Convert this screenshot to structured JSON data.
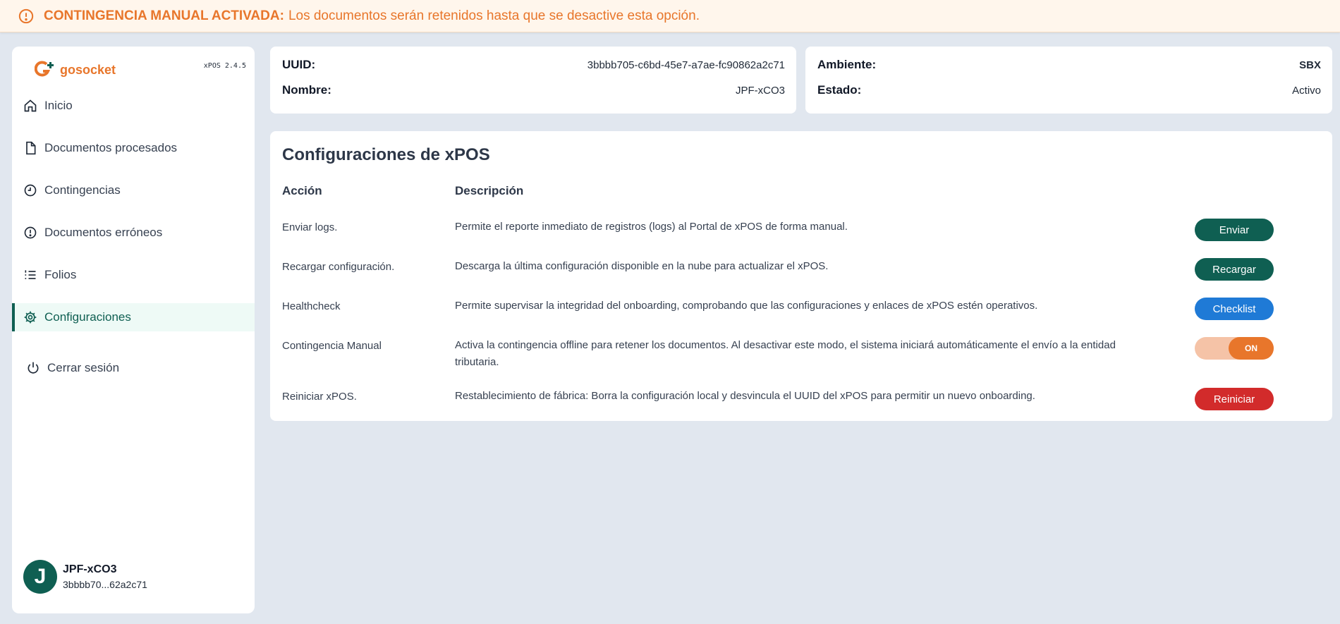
{
  "banner": {
    "title": "CONTINGENCIA MANUAL ACTIVADA:",
    "message": "Los documentos serán retenidos hasta que se desactive esta opción."
  },
  "sidebar": {
    "logo_text": "gosocket",
    "version": "xPOS 2.4.5",
    "items": [
      {
        "label": "Inicio",
        "icon": "home-icon"
      },
      {
        "label": "Documentos procesados",
        "icon": "file-icon"
      },
      {
        "label": "Contingencias",
        "icon": "clock-icon"
      },
      {
        "label": "Documentos erróneos",
        "icon": "alert-circle-icon"
      },
      {
        "label": "Folios",
        "icon": "list-icon"
      },
      {
        "label": "Configuraciones",
        "icon": "gear-icon",
        "active": true
      }
    ],
    "logout_label": "Cerrar sesión",
    "user": {
      "initial": "J",
      "name": "JPF-xCO3",
      "id": "3bbbb70...62a2c71"
    }
  },
  "device": {
    "uuid_label": "UUID:",
    "uuid_value": "3bbbb705-c6bd-45e7-a7ae-fc90862a2c71",
    "name_label": "Nombre:",
    "name_value": "JPF-xCO3",
    "env_label": "Ambiente:",
    "env_value": "SBX",
    "status_label": "Estado:",
    "status_value": "Activo"
  },
  "config": {
    "title": "Configuraciones de xPOS",
    "headers": {
      "action": "Acción",
      "description": "Descripción"
    },
    "rows": [
      {
        "action": "Enviar logs.",
        "description": "Permite el reporte inmediato de registros (logs) al Portal de xPOS de forma manual.",
        "button": "Enviar"
      },
      {
        "action": "Recargar configuración.",
        "description": "Descarga la última configuración disponible en la nube para actualizar el xPOS.",
        "button": "Recargar"
      },
      {
        "action": "Healthcheck",
        "description": "Permite supervisar la integridad del onboarding, comprobando que las configuraciones y enlaces de xPOS estén operativos.",
        "button": "Checklist"
      },
      {
        "action": "Contingencia Manual",
        "description": "Activa la contingencia offline para retener los documentos. Al desactivar este modo, el sistema iniciará automáticamente el envío a la entidad tributaria.",
        "toggle": "ON"
      },
      {
        "action": "Reiniciar xPOS.",
        "description": "Restablecimiento de fábrica: Borra la configuración local y desvincula el UUID del xPOS para permitir un nuevo onboarding.",
        "button": "Reiniciar"
      }
    ]
  },
  "colors": {
    "brand_green": "#0f5f52",
    "accent_orange": "#e8762b",
    "blue": "#1f7ad6",
    "red": "#d22b2b"
  }
}
